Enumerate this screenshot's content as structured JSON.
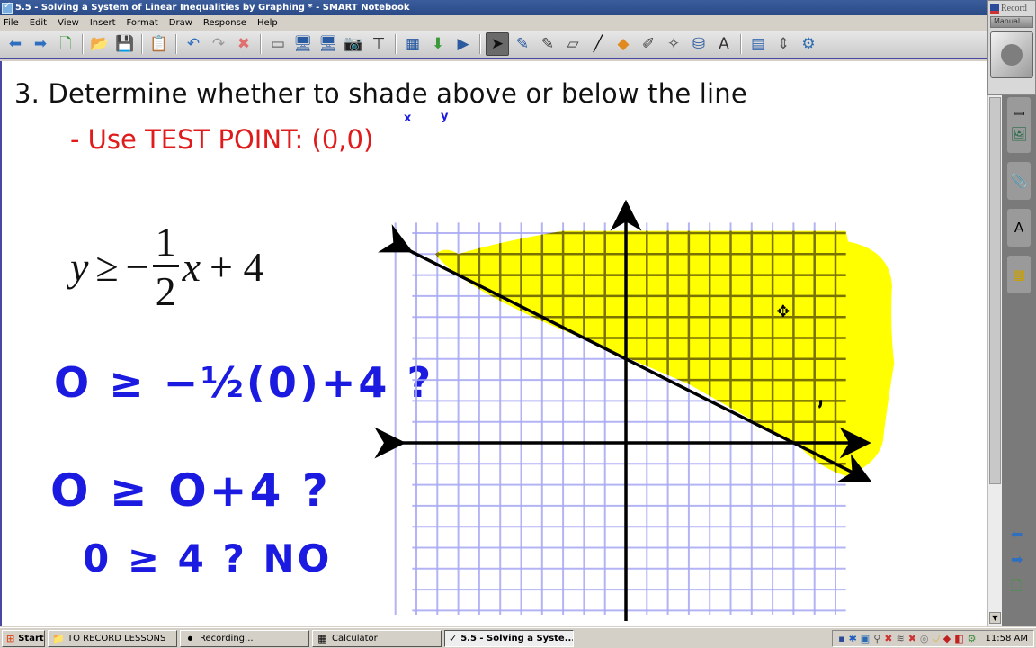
{
  "window": {
    "title": "5.5 - Solving a System of Linear Inequalities by Graphing * - SMART Notebook"
  },
  "menu": [
    "File",
    "Edit",
    "View",
    "Insert",
    "Format",
    "Draw",
    "Response",
    "Help"
  ],
  "toolbar": {
    "groups": [
      [
        {
          "name": "back-icon",
          "glyph": "⬅",
          "color": "#2f6fbf"
        },
        {
          "name": "forward-icon",
          "glyph": "➡",
          "color": "#2f6fbf"
        },
        {
          "name": "add-page-icon",
          "glyph": "🗋",
          "color": "#3a9a3a"
        }
      ],
      [
        {
          "name": "open-folder-icon",
          "glyph": "📂",
          "color": "#d8a020"
        },
        {
          "name": "save-icon",
          "glyph": "💾",
          "color": "#2a5aa0"
        }
      ],
      [
        {
          "name": "paste-icon",
          "glyph": "📋",
          "color": "#555555"
        }
      ],
      [
        {
          "name": "undo-icon",
          "glyph": "↶",
          "color": "#2f6fbf"
        },
        {
          "name": "redo-icon",
          "glyph": "↷",
          "color": "#999999"
        },
        {
          "name": "delete-icon",
          "glyph": "✖",
          "color": "#e07070"
        }
      ],
      [
        {
          "name": "show-hide-screen-shade-icon",
          "glyph": "▭",
          "color": "#555555"
        },
        {
          "name": "full-screen-icon",
          "glyph": "🖥",
          "color": "#2a5aa0"
        },
        {
          "name": "dual-page-icon",
          "glyph": "🖥",
          "color": "#2a5aa0"
        },
        {
          "name": "screen-capture-icon",
          "glyph": "📷",
          "color": "#555555"
        },
        {
          "name": "document-camera-icon",
          "glyph": "⊤",
          "color": "#333333"
        }
      ],
      [
        {
          "name": "table-icon",
          "glyph": "▦",
          "color": "#2a5aa0"
        },
        {
          "name": "insert-response-icon",
          "glyph": "⬇",
          "color": "#3a9a3a"
        },
        {
          "name": "slide-show-icon",
          "glyph": "▶",
          "color": "#2a5aa0"
        }
      ],
      [
        {
          "name": "select-icon",
          "glyph": "➤",
          "color": "#111111",
          "active": true
        },
        {
          "name": "pen-icon",
          "glyph": "✎",
          "color": "#2a5aa0"
        },
        {
          "name": "creative-pen-icon",
          "glyph": "✎",
          "color": "#444444"
        },
        {
          "name": "eraser-icon",
          "glyph": "▱",
          "color": "#444444"
        },
        {
          "name": "line-icon",
          "glyph": "╱",
          "color": "#111111"
        },
        {
          "name": "shapes-icon",
          "glyph": "◆",
          "color": "#e08a20"
        },
        {
          "name": "shape-recognition-pen-icon",
          "glyph": "✐",
          "color": "#444444"
        },
        {
          "name": "magic-pen-icon",
          "glyph": "✧",
          "color": "#444444"
        },
        {
          "name": "fill-icon",
          "glyph": "⛁",
          "color": "#2a5aa0"
        },
        {
          "name": "text-icon",
          "glyph": "A",
          "color": "#333333"
        }
      ],
      [
        {
          "name": "properties-icon",
          "glyph": "▤",
          "color": "#3a6ab0"
        },
        {
          "name": "move-toolbar-icon",
          "glyph": "⇕",
          "color": "#555555"
        },
        {
          "name": "customize-toolbar-icon",
          "glyph": "⚙",
          "color": "#2a6ab0"
        }
      ]
    ]
  },
  "page": {
    "heading": "3.  Determine whether to shade above or below the line",
    "subheading_prefix": "- Use TEST POINT: ",
    "test_point": "(0,0)",
    "test_point_annotations": {
      "x_label": "x",
      "y_label": "y"
    },
    "equation": {
      "lhs": "y",
      "relation": "≥",
      "sign": "−",
      "numerator": "1",
      "denominator": "2",
      "variable": "x",
      "rest": "+ 4"
    },
    "handwritten_work": [
      {
        "text": "O ≥ −½(0)+4 ?"
      },
      {
        "text": "O ≥ O+4 ?"
      },
      {
        "text": "0 ≥ 4 ? NO"
      }
    ],
    "graph": {
      "boundary": {
        "slope": -0.5,
        "intercept": 4,
        "style": "solid"
      },
      "shaded_region": "above the line",
      "shade_color": "#ffff00",
      "grid_color": "#a8a8f4",
      "grid_x_range": [
        -13,
        14
      ],
      "grid_y_range": [
        -12,
        7
      ]
    }
  },
  "record_widget": {
    "title": "Record",
    "dropdown": "Manual"
  },
  "side_tabs": [
    {
      "name": "page-sorter-tab-icon",
      "glyph": "▤"
    },
    {
      "name": "gallery-tab-icon",
      "glyph": "🖼"
    },
    {
      "name": "attachments-tab-icon",
      "glyph": "📎"
    },
    {
      "name": "properties-tab-icon",
      "glyph": "A"
    },
    {
      "name": "addons-tab-icon",
      "glyph": "▦"
    }
  ],
  "side_nav": [
    {
      "name": "previous-page-icon",
      "glyph": "⬅"
    },
    {
      "name": "next-page-icon",
      "glyph": "➡"
    },
    {
      "name": "add-page-icon",
      "glyph": "🗋"
    }
  ],
  "taskbar": {
    "start": "Start",
    "buttons": [
      {
        "label": "TO RECORD LESSONS",
        "icon": "folder-icon",
        "glyph": "📁"
      },
      {
        "label": "Recording...",
        "icon": "recorder-icon",
        "glyph": "⏺"
      },
      {
        "label": "Calculator",
        "icon": "calculator-icon",
        "glyph": "▦"
      },
      {
        "label": "5.5 - Solving a Syste...",
        "icon": "smart-notebook-icon",
        "glyph": "✓",
        "active": true
      }
    ],
    "tray_icons": [
      "recorder-tray-icon",
      "bluetooth-icon",
      "display-icon",
      "satellite-icon",
      "network-disconnected-icon",
      "wireless-icon",
      "network-disconnected-icon",
      "speaker-icon",
      "security-shield-icon",
      "adobe-icon",
      "smart-board-icon",
      "connection-icon"
    ],
    "clock": "11:58 AM"
  }
}
